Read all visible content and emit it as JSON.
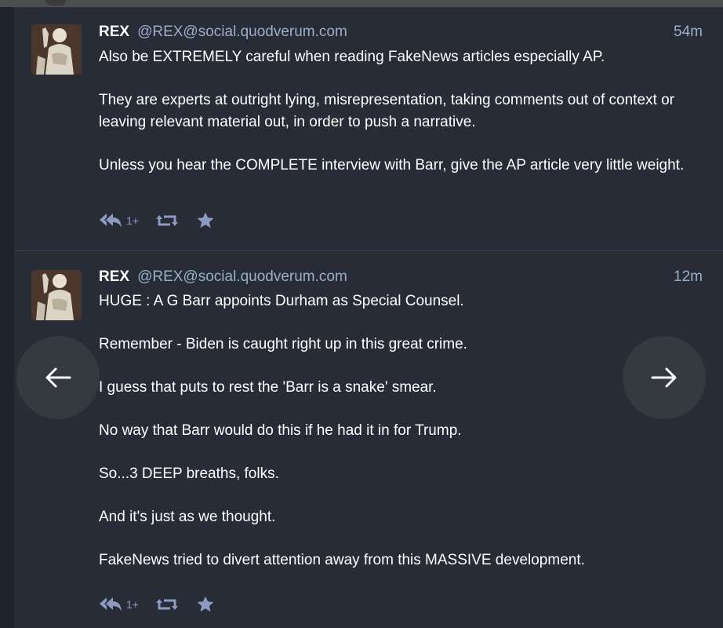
{
  "statuses": [
    {
      "display_name": "REX",
      "acct": "@REX@social.quodverum.com",
      "time": "54m",
      "paragraphs": [
        "Also be EXTREMELY careful when reading FakeNews articles especially AP.",
        "They are experts at outright lying, misrepresentation, taking comments out of context or leaving relevant material out, in order to push a narrative.",
        "Unless you hear the COMPLETE interview with Barr, give the AP article very little weight."
      ],
      "reply_count": "1+"
    },
    {
      "display_name": "REX",
      "acct": "@REX@social.quodverum.com",
      "time": "12m",
      "paragraphs": [
        "HUGE : A G Barr appoints Durham as Special Counsel.",
        "Remember - Biden is caught right up in this great crime.",
        "I guess that puts to rest the 'Barr is a snake' smear.",
        "No way that Barr would do this if he had it in for Trump.",
        "So...3 DEEP breaths, folks.",
        "And it's just as we thought.",
        "FakeNews tried to divert attention away from this MASSIVE development."
      ],
      "reply_count": "1+"
    }
  ],
  "icons": {
    "reply_all": "reply-all-icon",
    "boost": "retweet-icon",
    "favourite": "star-icon",
    "prev": "arrow-left-icon",
    "next": "arrow-right-icon"
  },
  "colors": {
    "background": "#282c37",
    "muted_text": "#9baec8",
    "icon": "#8d9ac2",
    "divider": "#393f4f",
    "nav_button": "#353a40"
  }
}
